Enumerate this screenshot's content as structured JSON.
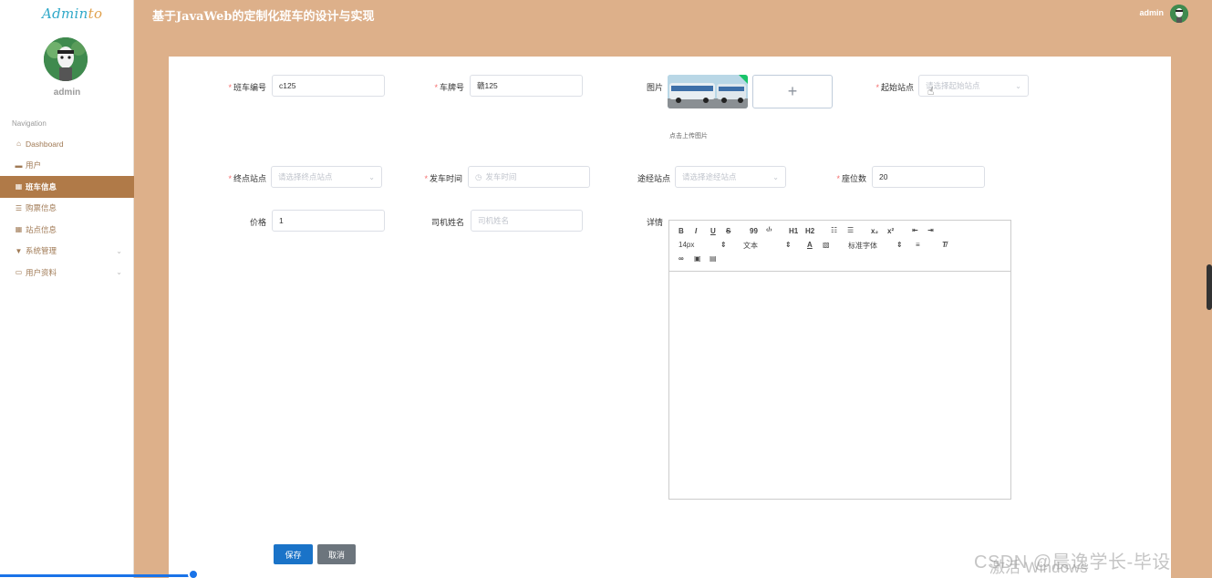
{
  "app": {
    "logo_main": "Admin",
    "logo_tail": "to"
  },
  "sidebar": {
    "username": "admin",
    "nav_label": "Navigation",
    "items": [
      {
        "label": "Dashboard",
        "icon": "home-icon"
      },
      {
        "label": "用户",
        "icon": "user-icon"
      },
      {
        "label": "班车信息",
        "icon": "grid-icon"
      },
      {
        "label": "购票信息",
        "icon": "list-icon"
      },
      {
        "label": "站点信息",
        "icon": "grid-icon"
      },
      {
        "label": "系统管理",
        "icon": "cup-icon"
      },
      {
        "label": "用户资料",
        "icon": "card-icon"
      }
    ]
  },
  "header": {
    "title": "基于JavaWeb的定制化班车的设计与实现",
    "user": "admin"
  },
  "form": {
    "bus_no": {
      "label": "班车编号",
      "value": "c125"
    },
    "plate": {
      "label": "车牌号",
      "value": "赣125"
    },
    "image": {
      "label": "图片",
      "tip": "点击上传图片",
      "plus": "+"
    },
    "start": {
      "label": "起始站点",
      "placeholder": "请选择起始站点"
    },
    "end": {
      "label": "终点站点",
      "placeholder": "请选择终点站点"
    },
    "depart": {
      "label": "发车时间",
      "placeholder": "发车时间"
    },
    "via": {
      "label": "途经站点",
      "placeholder": "请选择途经站点"
    },
    "seats": {
      "label": "座位数",
      "value": "20"
    },
    "price": {
      "label": "价格",
      "value": "1"
    },
    "driver": {
      "label": "司机姓名",
      "placeholder": "司机姓名"
    },
    "detail": {
      "label": "详情"
    }
  },
  "editor": {
    "font_size": "14px",
    "text_style": "文本",
    "font_family": "标准字体",
    "bold": "B",
    "italic": "I",
    "underline": "U",
    "strike": "S",
    "quote": "99",
    "code": "‹/›",
    "h1": "H1",
    "h2": "H2",
    "sub": "x₂",
    "sup": "x²"
  },
  "buttons": {
    "save": "保存",
    "cancel": "取消"
  },
  "colors": {
    "accent": "#ddb08a",
    "active": "#b07a48",
    "primary": "#1a73e8"
  },
  "watermark": {
    "csdn": "CSDN @晨逸学长-毕设",
    "windows": "激活 Windows"
  }
}
